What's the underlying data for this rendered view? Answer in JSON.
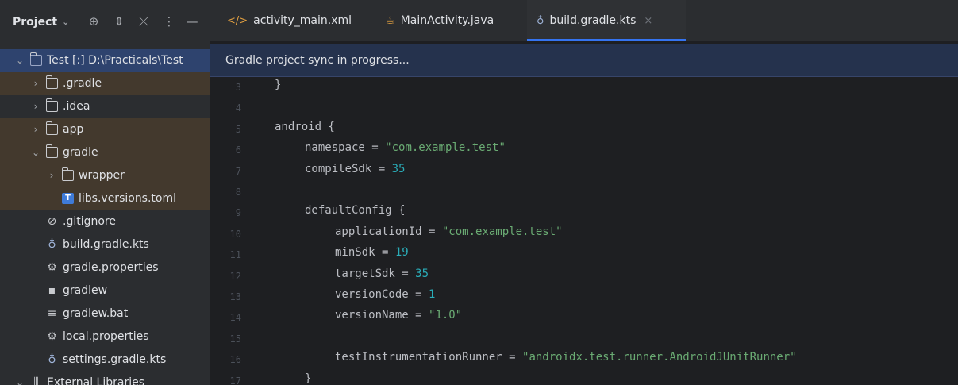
{
  "panel": {
    "title": "Project",
    "tree": [
      {
        "label": "Test [:] D:\\Practicals\\Test",
        "depth": 0,
        "arrow": "v",
        "icon": "module-icon",
        "highlight": "blue"
      },
      {
        "label": ".gradle",
        "depth": 1,
        "arrow": ">",
        "icon": "folder-icon",
        "highlight": "brown"
      },
      {
        "label": ".idea",
        "depth": 1,
        "arrow": ">",
        "icon": "folder-icon",
        "highlight": ""
      },
      {
        "label": "app",
        "depth": 1,
        "arrow": ">",
        "icon": "folder-icon",
        "highlight": "brown"
      },
      {
        "label": "gradle",
        "depth": 1,
        "arrow": "v",
        "icon": "folder-icon",
        "highlight": "brown"
      },
      {
        "label": "wrapper",
        "depth": 2,
        "arrow": ">",
        "icon": "folder-icon",
        "highlight": "brown"
      },
      {
        "label": "libs.versions.toml",
        "depth": 2,
        "arrow": "",
        "icon": "toml-icon",
        "highlight": "brown"
      },
      {
        "label": ".gitignore",
        "depth": 1,
        "arrow": "",
        "icon": "ignore-icon",
        "highlight": ""
      },
      {
        "label": "build.gradle.kts",
        "depth": 1,
        "arrow": "",
        "icon": "gradle-icon",
        "highlight": ""
      },
      {
        "label": "gradle.properties",
        "depth": 1,
        "arrow": "",
        "icon": "settings-icon",
        "highlight": ""
      },
      {
        "label": "gradlew",
        "depth": 1,
        "arrow": "",
        "icon": "terminal-icon",
        "highlight": ""
      },
      {
        "label": "gradlew.bat",
        "depth": 1,
        "arrow": "",
        "icon": "text-icon",
        "highlight": ""
      },
      {
        "label": "local.properties",
        "depth": 1,
        "arrow": "",
        "icon": "settings-icon",
        "highlight": ""
      },
      {
        "label": "settings.gradle.kts",
        "depth": 1,
        "arrow": "",
        "icon": "gradle-icon",
        "highlight": ""
      },
      {
        "label": "External Libraries",
        "depth": 0,
        "arrow": "v",
        "icon": "library-icon",
        "highlight": ""
      }
    ]
  },
  "tabs": [
    {
      "label": "activity_main.xml",
      "icon": "xml-icon",
      "active": false
    },
    {
      "label": "MainActivity.java",
      "icon": "java-icon",
      "active": false
    },
    {
      "label": "build.gradle.kts",
      "icon": "gradle-icon",
      "active": true
    }
  ],
  "banner": {
    "text": "Gradle project sync in progress..."
  },
  "editor": {
    "lines": [
      {
        "num": "3",
        "indent": 0,
        "parts": [
          {
            "t": "}",
            "c": "ident"
          }
        ]
      },
      {
        "num": "4",
        "indent": 0,
        "parts": []
      },
      {
        "num": "5",
        "indent": 0,
        "parts": [
          {
            "t": "android {",
            "c": "ident"
          }
        ]
      },
      {
        "num": "6",
        "indent": 1,
        "parts": [
          {
            "t": "namespace = ",
            "c": "ident"
          },
          {
            "t": "\"com.example.test\"",
            "c": "str"
          }
        ]
      },
      {
        "num": "7",
        "indent": 1,
        "parts": [
          {
            "t": "compileSdk = ",
            "c": "ident"
          },
          {
            "t": "35",
            "c": "num"
          }
        ]
      },
      {
        "num": "8",
        "indent": 0,
        "parts": []
      },
      {
        "num": "9",
        "indent": 1,
        "parts": [
          {
            "t": "defaultConfig {",
            "c": "ident"
          }
        ]
      },
      {
        "num": "10",
        "indent": 2,
        "parts": [
          {
            "t": "applicationId = ",
            "c": "ident"
          },
          {
            "t": "\"com.example.test\"",
            "c": "str"
          }
        ]
      },
      {
        "num": "11",
        "indent": 2,
        "parts": [
          {
            "t": "minSdk = ",
            "c": "ident"
          },
          {
            "t": "19",
            "c": "num"
          }
        ]
      },
      {
        "num": "12",
        "indent": 2,
        "parts": [
          {
            "t": "targetSdk = ",
            "c": "ident"
          },
          {
            "t": "35",
            "c": "num"
          }
        ]
      },
      {
        "num": "13",
        "indent": 2,
        "parts": [
          {
            "t": "versionCode = ",
            "c": "ident"
          },
          {
            "t": "1",
            "c": "num"
          }
        ]
      },
      {
        "num": "14",
        "indent": 2,
        "parts": [
          {
            "t": "versionName = ",
            "c": "ident"
          },
          {
            "t": "\"1.0\"",
            "c": "str"
          }
        ]
      },
      {
        "num": "15",
        "indent": 0,
        "parts": []
      },
      {
        "num": "16",
        "indent": 2,
        "parts": [
          {
            "t": "testInstrumentationRunner = ",
            "c": "ident"
          },
          {
            "t": "\"androidx.test.runner.AndroidJUnitRunner\"",
            "c": "str"
          }
        ]
      },
      {
        "num": "17",
        "indent": 1,
        "parts": [
          {
            "t": "}",
            "c": "ident"
          }
        ]
      }
    ]
  },
  "colors": {
    "accent": "#3574f0",
    "string": "#6aab73",
    "number": "#2aacb8",
    "highlight_brown": "#43392d",
    "highlight_blue": "#2e436e"
  }
}
